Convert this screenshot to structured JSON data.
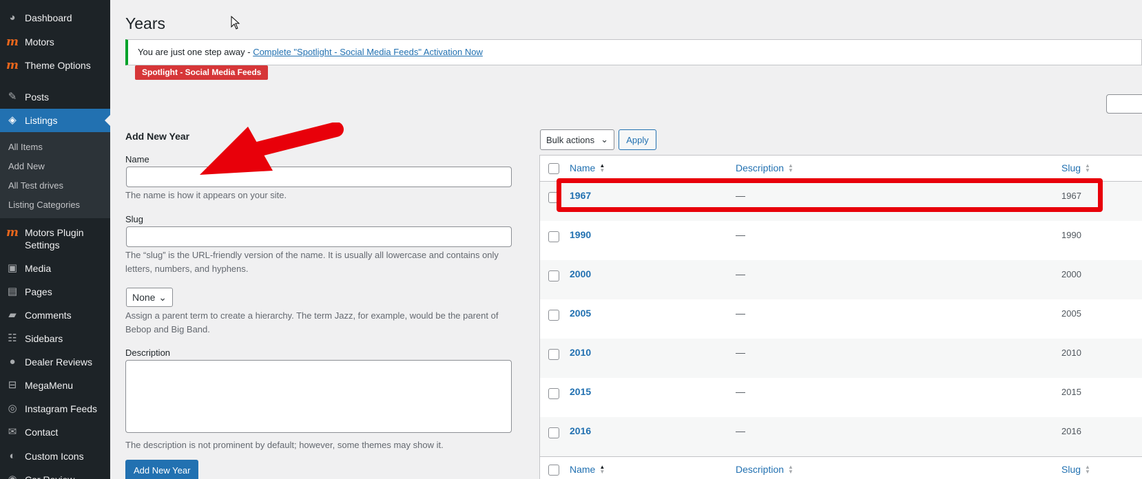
{
  "sidebar": {
    "items": [
      {
        "label": "Dashboard",
        "icon": "dashboard-icon"
      },
      {
        "label": "Motors",
        "icon": "motors-brand-icon"
      },
      {
        "label": "Theme Options",
        "icon": "motors-brand-icon"
      },
      {
        "label": "Posts",
        "icon": "pin-icon"
      },
      {
        "label": "Listings",
        "icon": "listings-icon"
      },
      {
        "label": "Motors Plugin Settings",
        "icon": "motors-brand-icon"
      },
      {
        "label": "Media",
        "icon": "media-icon"
      },
      {
        "label": "Pages",
        "icon": "pages-icon"
      },
      {
        "label": "Comments",
        "icon": "comments-icon"
      },
      {
        "label": "Sidebars",
        "icon": "sidebars-icon"
      },
      {
        "label": "Dealer Reviews",
        "icon": "users-icon"
      },
      {
        "label": "MegaMenu",
        "icon": "megamenu-icon"
      },
      {
        "label": "Instagram Feeds",
        "icon": "instagram-icon"
      },
      {
        "label": "Contact",
        "icon": "mail-icon"
      },
      {
        "label": "Custom Icons",
        "icon": "custom-icons-icon"
      },
      {
        "label": "Car Review",
        "icon": "car-review-icon"
      }
    ],
    "submenu": [
      "All Items",
      "Add New",
      "All Test drives",
      "Listing Categories"
    ]
  },
  "page": {
    "title": "Years",
    "notice_text": "You are just one step away - ",
    "notice_link": "Complete \"Spotlight - Social Media Feeds\" Activation Now",
    "badge": "Spotlight - Social Media Feeds"
  },
  "form": {
    "heading": "Add New Year",
    "name_label": "Name",
    "name_value": "",
    "name_hint": "The name is how it appears on your site.",
    "slug_label": "Slug",
    "slug_value": "",
    "slug_hint": "The “slug” is the URL-friendly version of the name. It is usually all lowercase and contains only letters, numbers, and hyphens.",
    "parent_value": "None",
    "parent_hint": "Assign a parent term to create a hierarchy. The term Jazz, for example, would be the parent of Bebop and Big Band.",
    "description_label": "Description",
    "description_hint": "The description is not prominent by default; however, some themes may show it.",
    "submit_label": "Add New Year"
  },
  "table": {
    "bulk_actions": "Bulk actions",
    "apply": "Apply",
    "columns": [
      "Name",
      "Description",
      "Slug"
    ],
    "rows": [
      {
        "name": "1967",
        "description": "—",
        "slug": "1967"
      },
      {
        "name": "1990",
        "description": "—",
        "slug": "1990"
      },
      {
        "name": "2000",
        "description": "—",
        "slug": "2000"
      },
      {
        "name": "2005",
        "description": "—",
        "slug": "2005"
      },
      {
        "name": "2010",
        "description": "—",
        "slug": "2010"
      },
      {
        "name": "2015",
        "description": "—",
        "slug": "2015"
      },
      {
        "name": "2016",
        "description": "—",
        "slug": "2016"
      }
    ]
  },
  "colors": {
    "accent": "#2271b1",
    "sidebar": "#1d2327",
    "annotation": "#e8000a",
    "brand": "#e8661c"
  }
}
